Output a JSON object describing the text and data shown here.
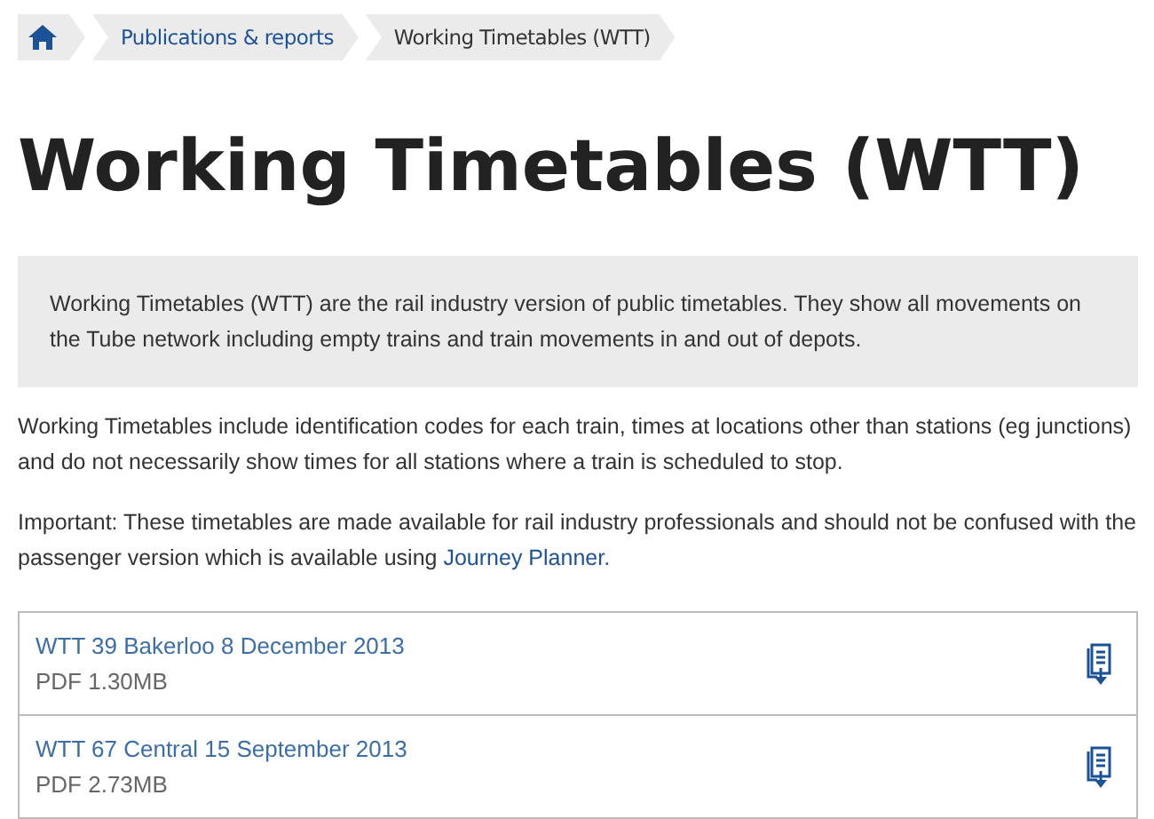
{
  "breadcrumb": [
    {
      "kind": "home"
    },
    {
      "kind": "link",
      "label": "Publications & reports"
    },
    {
      "kind": "current",
      "label": "Working Timetables (WTT)"
    }
  ],
  "title": "Working Timetables (WTT)",
  "intro": "Working Timetables (WTT) are the rail industry version of public timetables. They show all movements on the Tube network including empty trains and train movements in and out of depots.",
  "paragraphs": [
    {
      "text": "Working Timetables include identification codes for each train, times at locations other than stations (eg junctions) and do not necessarily show times for all stations where a train is scheduled to stop."
    },
    {
      "text": "Important: These timetables are made available for rail industry professionals and should not be confused with the passenger version which is available using",
      "link": "Journey Planner."
    }
  ],
  "documents": [
    {
      "title": "WTT 39 Bakerloo 8 December 2013",
      "meta": "PDF 1.30MB"
    },
    {
      "title": "WTT 67 Central 15 September 2013",
      "meta": "PDF 2.73MB"
    }
  ]
}
